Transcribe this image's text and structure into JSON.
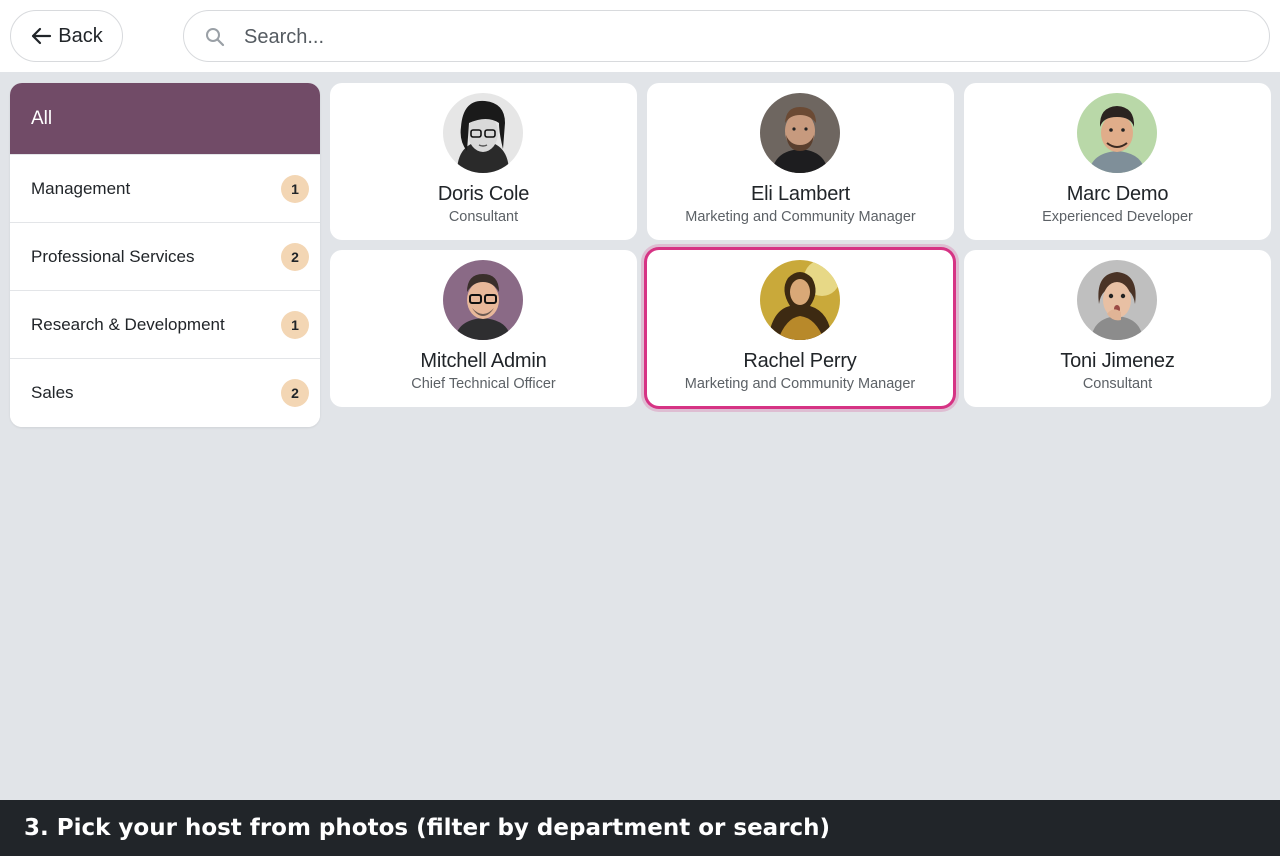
{
  "header": {
    "back_label": "Back",
    "search_placeholder": "Search..."
  },
  "departments": [
    {
      "label": "All",
      "count": null,
      "active": true
    },
    {
      "label": "Management",
      "count": "1",
      "active": false
    },
    {
      "label": "Professional Services",
      "count": "2",
      "active": false
    },
    {
      "label": "Research & Development",
      "count": "1",
      "active": false
    },
    {
      "label": "Sales",
      "count": "2",
      "active": false
    }
  ],
  "employees": [
    {
      "name": "Doris Cole",
      "job": "Consultant",
      "avatar_icon": "woman-beanie-glasses-avatar"
    },
    {
      "name": "Eli Lambert",
      "job": "Marketing and Community Manager",
      "avatar_icon": "man-beard-avatar"
    },
    {
      "name": "Marc Demo",
      "job": "Experienced Developer",
      "avatar_icon": "man-cartoon-avatar"
    },
    {
      "name": "Mitchell Admin",
      "job": "Chief Technical Officer",
      "avatar_icon": "man-glasses-cartoon-avatar"
    },
    {
      "name": "Rachel Perry",
      "job": "Marketing and Community Manager",
      "avatar_icon": "woman-golden-avatar",
      "selected": true
    },
    {
      "name": "Toni Jimenez",
      "job": "Consultant",
      "avatar_icon": "woman-surprised-avatar"
    }
  ],
  "caption": "3. Pick your host from photos (filter by department or search)",
  "colors": {
    "accent": "#714b67",
    "badge": "#f3d6b4",
    "selection": "#d63384",
    "background": "#e1e4e8"
  }
}
